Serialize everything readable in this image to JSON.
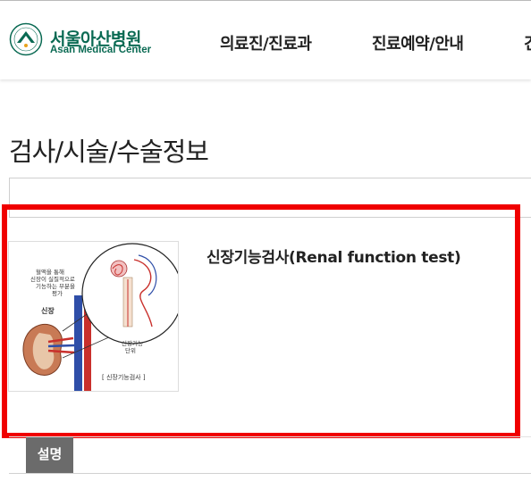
{
  "header": {
    "logo": {
      "name_ko": "서울아산병원",
      "name_en": "Asan Medical Center",
      "brand_color": "#0a6a53"
    },
    "nav": [
      {
        "label": "의료진/진료과"
      },
      {
        "label": "진료예약/안내"
      },
      {
        "label": "건"
      }
    ]
  },
  "page": {
    "title": "검사/시술/수술정보"
  },
  "result": {
    "title": "신장기능검사(Renal function test)",
    "image": {
      "icon": "kidney-illustration",
      "labels": {
        "callout": [
          "혈액을 통해",
          "신장이 실질적으로",
          "기능하는 부분을",
          "평가"
        ],
        "kidney": "신장",
        "unit": [
          "신장기능",
          "단위"
        ],
        "caption": "[ 신장기능검사 ]"
      }
    }
  },
  "tabs": [
    {
      "label": "설명"
    }
  ],
  "colors": {
    "highlight": "#f00000",
    "tab_bg": "#6b6b6b"
  }
}
